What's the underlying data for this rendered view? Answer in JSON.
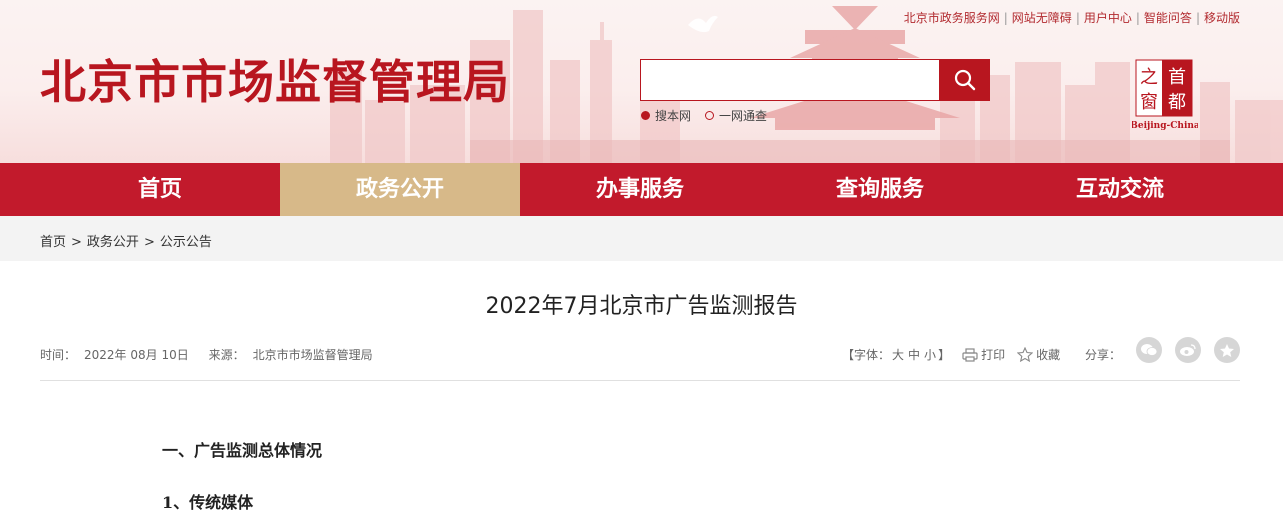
{
  "header": {
    "site_title": "北京市市场监督管理局",
    "top_links": [
      "北京市政务服务网",
      "网站无障碍",
      "用户中心",
      "智能问答",
      "移动版"
    ],
    "search": {
      "placeholder": "",
      "options": [
        "搜本网",
        "一网通查"
      ],
      "selected": "搜本网"
    },
    "capital_logo": {
      "chars": [
        "首",
        "都",
        "之",
        "窗"
      ],
      "caption": "Beijing-China"
    }
  },
  "nav": {
    "items": [
      "首页",
      "政务公开",
      "办事服务",
      "查询服务",
      "互动交流"
    ],
    "active": "政务公开"
  },
  "breadcrumb": [
    "首页",
    "政务公开",
    "公示公告"
  ],
  "article": {
    "title": "2022年7月北京市广告监测报告",
    "time_label": "时间：",
    "time_value": "2022年 08月 10日",
    "source_label": "来源：",
    "source_value": "北京市市场监督管理局",
    "font_size_prefix": "【字体：",
    "font_sizes": [
      "大",
      "中",
      "小"
    ],
    "font_size_suffix": "】",
    "print_label": "打印",
    "favorite_label": "收藏",
    "share_label": "分享：",
    "section1": "一、广告监测总体情况",
    "section2": "1、传统媒体"
  },
  "colors": {
    "brand_red": "#c21a2c",
    "nav_active": "#d7b989",
    "title_red": "#b8161f"
  }
}
